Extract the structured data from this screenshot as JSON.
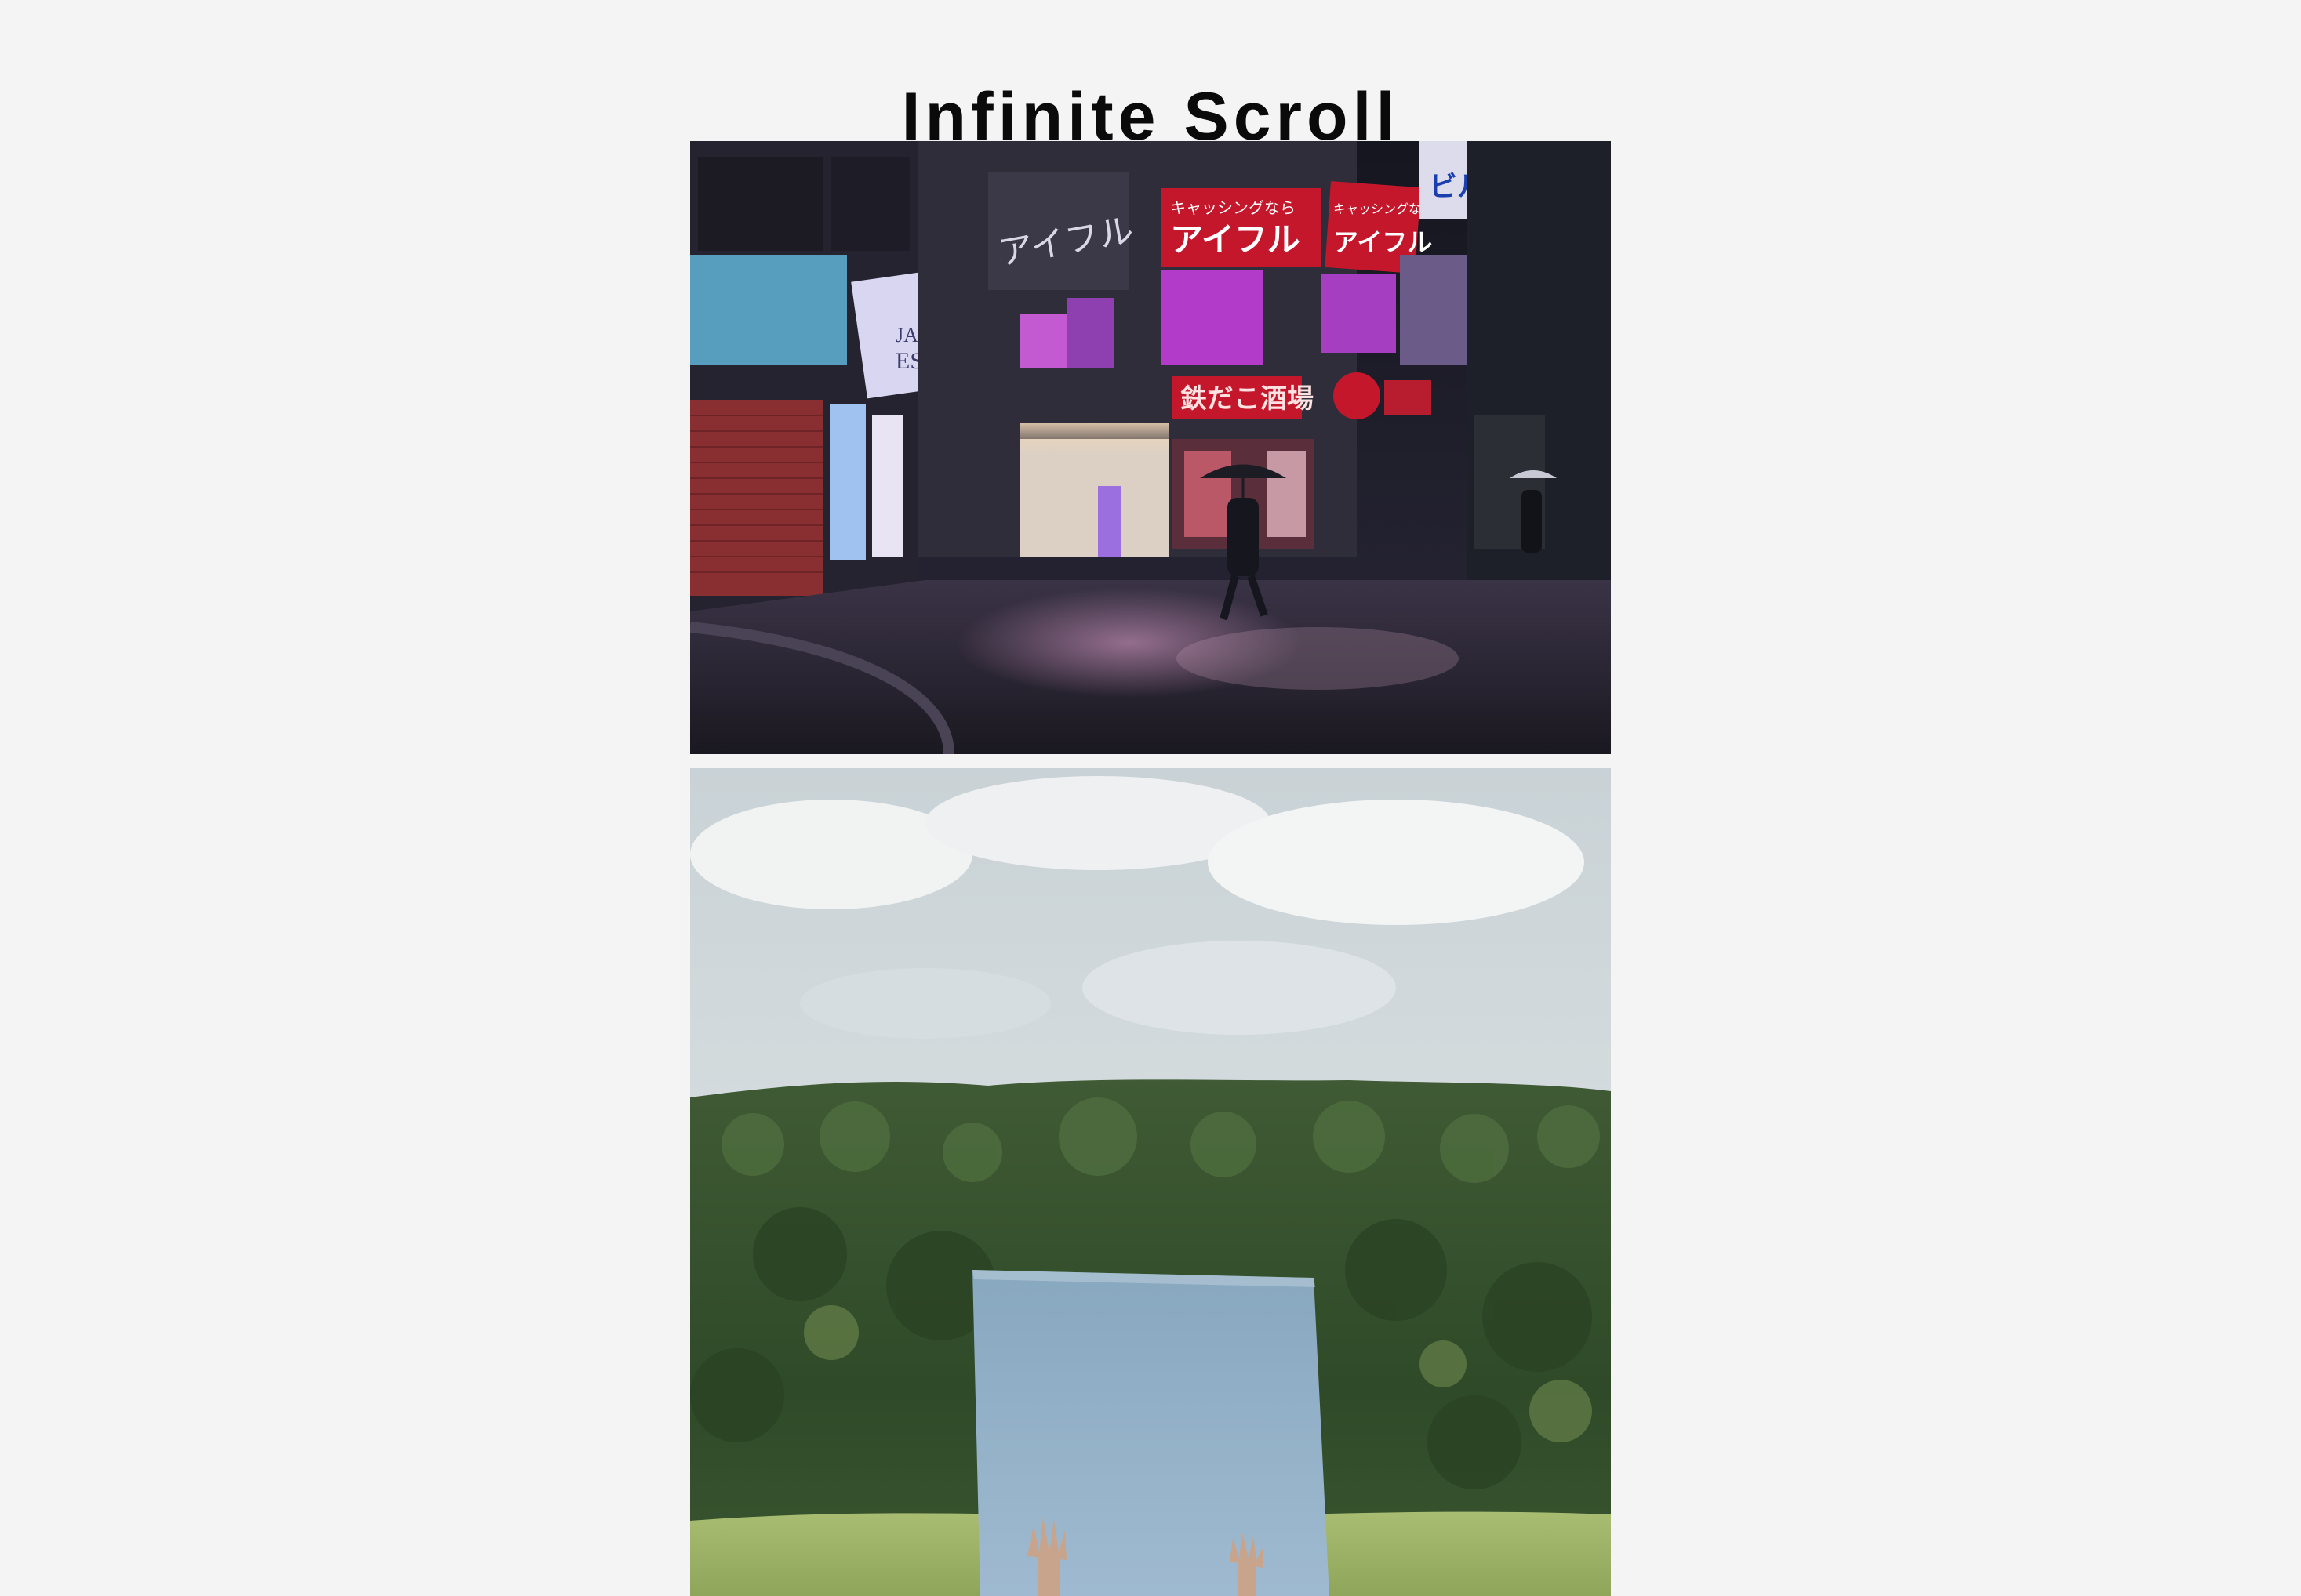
{
  "header": {
    "title": "Infinite Scroll"
  },
  "feed": {
    "photos": [
      {
        "subject": "rainy-tokyo-street-at-night",
        "signs": {
          "loan_top": "キャッシングなら",
          "loan_main": "アイフル",
          "loan_top_2": "キャッシングなら",
          "loan_main_2": "アイフル",
          "building": "アイフル",
          "realestate_1": "JAPAN",
          "realestate_2": "ESTATE",
          "izakaya": "鉄だこ酒場",
          "vertical_sign": "ビル"
        }
      },
      {
        "subject": "mirror-in-field-with-raised-hands"
      }
    ]
  },
  "colors": {
    "background": "#f4f4f4",
    "title": "#0a0a0a",
    "sign_red": "#c4172b",
    "neon_purple": "#b23bc9"
  }
}
